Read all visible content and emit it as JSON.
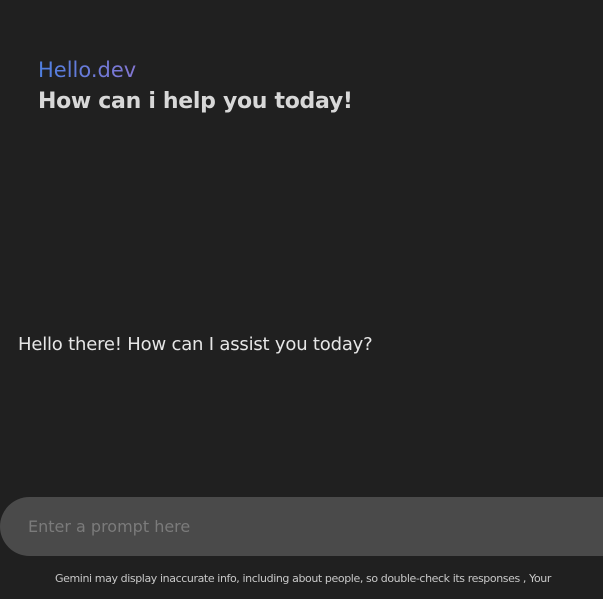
{
  "header": {
    "greeting": "Hello.dev",
    "subtitle": "How can i help you today!"
  },
  "chat": {
    "response": "Hello there! How can I assist you today?"
  },
  "prompt": {
    "placeholder": "Enter a prompt here",
    "value": ""
  },
  "footer": {
    "disclaimer": "Gemini may display inaccurate info, including about people, so double-check its responses , Your"
  },
  "colors": {
    "background": "#202020",
    "prompt_bar": "#4a4a4a",
    "gradient_start": "#4e7fe0",
    "gradient_mid": "#9b72cb",
    "gradient_end": "#d9596b"
  }
}
